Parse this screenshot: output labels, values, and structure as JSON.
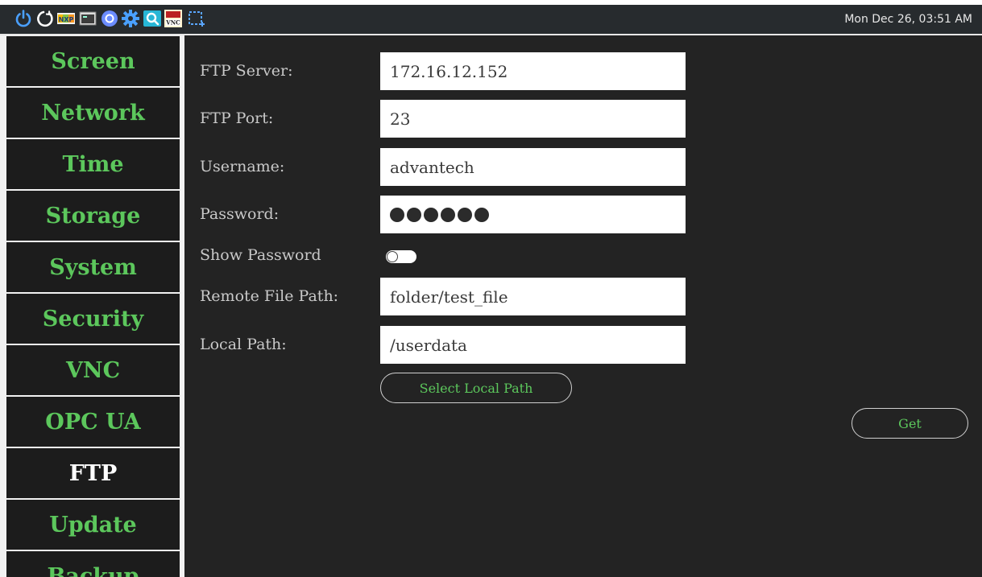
{
  "taskbar": {
    "icons": [
      "power-icon",
      "restart-icon",
      "nxp-logo-icon",
      "terminal-icon",
      "browser-icon",
      "gear-icon",
      "search-app-icon",
      "tightvnc-icon",
      "screenshot-icon"
    ],
    "clock": "Mon Dec 26, 03:51 AM"
  },
  "sidebar": {
    "items": [
      {
        "label": "Screen"
      },
      {
        "label": "Network"
      },
      {
        "label": "Time"
      },
      {
        "label": "Storage"
      },
      {
        "label": "System"
      },
      {
        "label": "Security"
      },
      {
        "label": "VNC"
      },
      {
        "label": "OPC UA"
      },
      {
        "label": "FTP",
        "active": true
      },
      {
        "label": "Update"
      },
      {
        "label": "Backup"
      }
    ]
  },
  "ftp": {
    "server_label": "FTP Server:",
    "server_value": "172.16.12.152",
    "port_label": "FTP Port:",
    "port_value": "23",
    "username_label": "Username:",
    "username_value": "advantech",
    "password_label": "Password:",
    "password_dot_count": 6,
    "show_password_label": "Show Password",
    "show_password_on": false,
    "remote_path_label": "Remote File Path:",
    "remote_path_value": "folder/test_file",
    "local_path_label": "Local Path:",
    "local_path_value": "/userdata",
    "select_local_path_button": "Select Local Path",
    "get_button": "Get"
  },
  "colors": {
    "accent_green": "#5cc75c",
    "panel_bg": "#232323",
    "nav_bg": "#1c1c1c",
    "taskbar_bg": "#272b2e"
  }
}
